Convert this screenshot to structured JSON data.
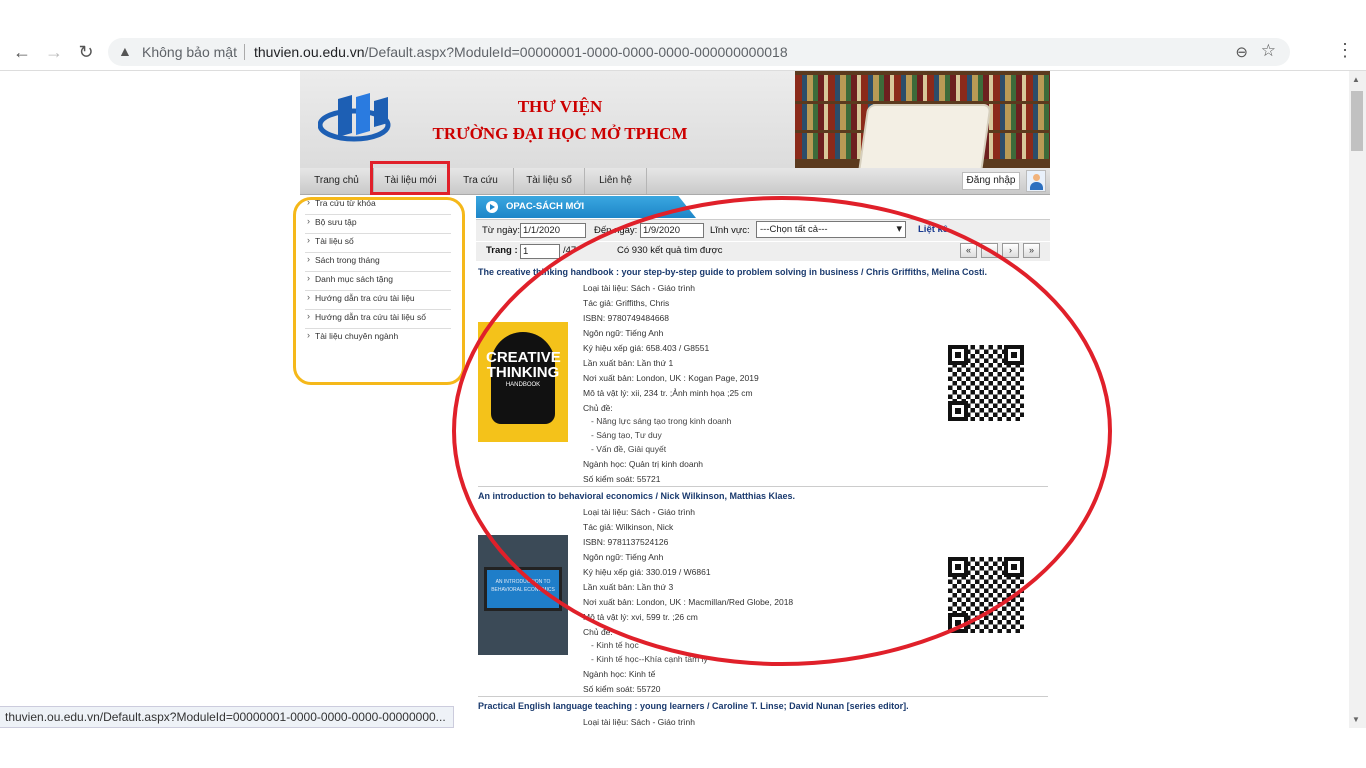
{
  "browser": {
    "security_label": "Không bảo mật",
    "url_host": "thuvien.ou.edu.vn",
    "url_path": "/Default.aspx?ModuleId=00000001-0000-0000-0000-000000000018",
    "status_bar": "thuvien.ou.edu.vn/Default.aspx?ModuleId=00000001-0000-0000-0000-00000000..."
  },
  "header": {
    "title_line1": "THƯ VIỆN",
    "title_line2": "TRƯỜNG ĐẠI HỌC MỞ TPHCM"
  },
  "nav": {
    "items": [
      "Trang chủ",
      "Tài liệu mới",
      "Tra cứu",
      "Tài liệu số",
      "Liên hệ"
    ],
    "login": "Đăng nhập"
  },
  "sidebar": {
    "items": [
      "Tra cứu từ khóa",
      "Bộ sưu tập",
      "Tài liệu số",
      "Sách trong tháng",
      "Danh mục sách tặng",
      "Hướng dẫn tra cứu tài liệu",
      "Hướng dẫn tra cứu tài liệu số",
      "Tài liệu chuyên ngành"
    ]
  },
  "main": {
    "section_title": "OPAC-SÁCH MỚI",
    "filter": {
      "from_label": "Từ ngày:",
      "from_value": "1/1/2020",
      "to_label": "Đến ngày:",
      "to_value": "1/9/2020",
      "field_label": "Lĩnh vực:",
      "field_value": "---Chọn tất cả---",
      "list_link": "Liệt kê"
    },
    "pager": {
      "page_label": "Trang :",
      "page_value": "1",
      "page_total": "/47",
      "results": "Có 930 kết quả tìm được",
      "first": "«",
      "prev": "‹",
      "next": "›",
      "last": "»"
    },
    "records": [
      {
        "title": "The creative thinking handbook : your step-by-step guide to problem solving in business / Chris Griffiths, Melina Costi.",
        "cover_title": "CREATIVE THINKING",
        "cover_subtitle": "HANDBOOK",
        "fields": [
          "Loại tài liệu:  Sách - Giáo trình",
          "Tác giả: Griffiths, Chris",
          "ISBN:  9780749484668",
          "Ngôn ngữ:  Tiếng Anh",
          "Ký hiệu xếp giá:  658.403 / G8551",
          "Lần xuất bản:  Lần thứ 1",
          "Nơi xuất bản:  London, UK : Kogan Page, 2019",
          "Mô tả vật lý:  xii, 234 tr. ;Ảnh minh họa ;25 cm",
          "Chủ đề:"
        ],
        "subjects": [
          "- Năng lực sáng tạo trong kinh doanh",
          "- Sáng tạo, Tư duy",
          "- Vấn đề, Giải quyết"
        ],
        "tail": [
          "Ngành học:  Quản trị kinh doanh",
          "Số kiểm soát:  55721"
        ]
      },
      {
        "title": "An introduction to behavioral economics / Nick Wilkinson, Matthias Klaes.",
        "cover_title": "AN INTRODUCTION TO BEHAVIORAL ECONOMICS",
        "fields": [
          "Loại tài liệu:  Sách - Giáo trình",
          "Tác giả: Wilkinson, Nick",
          "ISBN:  9781137524126",
          "Ngôn ngữ:  Tiếng Anh",
          "Ký hiệu xếp giá:  330.019 / W6861",
          "Lần xuất bản:  Lần thứ 3",
          "Nơi xuất bản:  London, UK : Macmillan/Red Globe, 2018",
          "Mô tả vật lý:  xvi, 599 tr. ;26 cm",
          "Chủ đề:"
        ],
        "subjects": [
          "- Kinh tế học",
          "- Kinh tế học--Khía cạnh tâm lý"
        ],
        "tail": [
          "Ngành học:  Kinh tế",
          "Số kiểm soát:  55720"
        ]
      },
      {
        "title": "Practical English language teaching : young learners / Caroline T. Linse; David Nunan [series editor].",
        "fields": [
          "Loại tài liệu:  Sách - Giáo trình"
        ]
      }
    ]
  },
  "colors": {
    "annotation_red": "#e0202a",
    "annotation_yellow": "#f5b81a",
    "tab_blue": "#1e86c8",
    "title_red": "#cc0000"
  }
}
